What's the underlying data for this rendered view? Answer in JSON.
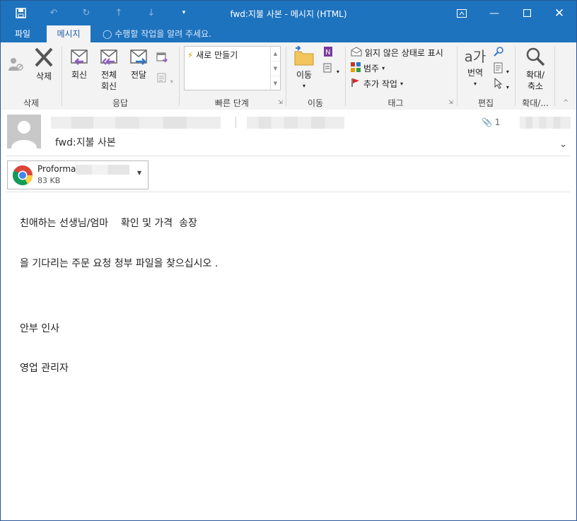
{
  "window": {
    "title": "fwd:지불 사본 - 메시지 (HTML)"
  },
  "ribbon_tabs": {
    "file": "파일",
    "message": "메시지",
    "tell_me": "수행할 작업을 알려 주세요."
  },
  "ribbon": {
    "delete_label": "삭제",
    "reply_label": "회신",
    "reply_all_line1": "전체",
    "reply_all_line2": "회신",
    "forward_label": "전달",
    "quick_steps_item": "새로 만들기",
    "move_label": "이동",
    "mark_unread": "읽지 않은 상태로 표시",
    "categorize": "범주",
    "follow_up": "추가 작업",
    "translate_label": "번역",
    "zoom_line1": "확대/",
    "zoom_line2": "축소",
    "groups": {
      "delete": "삭제",
      "respond": "응답",
      "quick_steps": "빠른 단계",
      "move": "이동",
      "tags": "태그",
      "editing": "편집",
      "zoom": "확대/..."
    },
    "accent_color": "#1e73be"
  },
  "message": {
    "subject": "fwd:지불 사본",
    "attachment_count": "1",
    "attachment": {
      "name": "Proforma",
      "size": "83 KB"
    },
    "body": [
      "친애하는 선생님/엄마    확인 및 가격  송장",
      "을 기다리는 주문 요청 청부 파일을 찾으십시오 .",
      "안부 인사",
      "영업 관리자"
    ]
  }
}
